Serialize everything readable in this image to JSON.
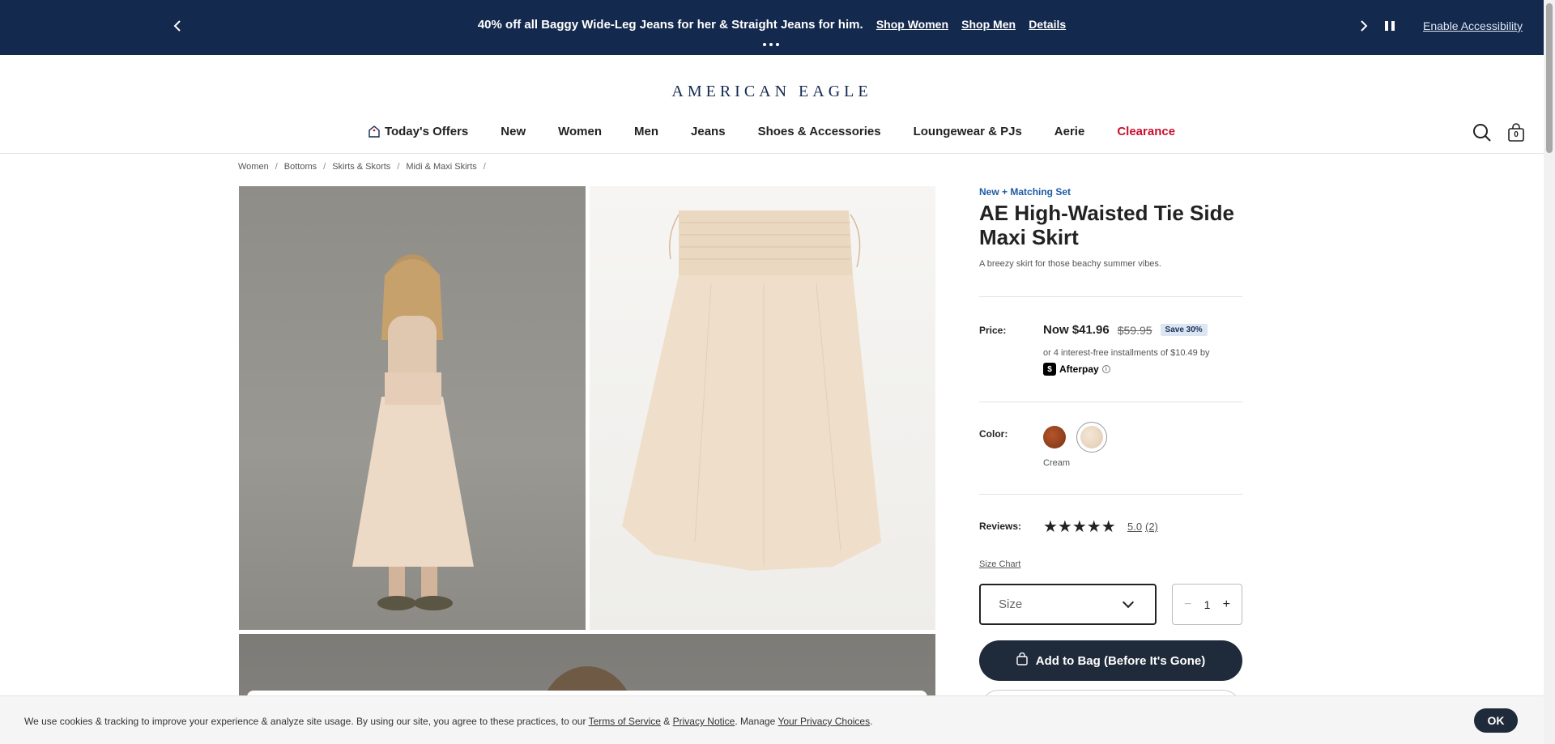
{
  "promo": {
    "message": "40% off all Baggy Wide-Leg Jeans for her & Straight Jeans for him.",
    "links": [
      "Shop Women",
      "Shop Men",
      "Details"
    ],
    "accessibility": "Enable Accessibility",
    "prev_icon": "chevron-left-icon",
    "next_icon": "chevron-right-icon",
    "pause_icon": "pause-icon"
  },
  "brand": "AMERICAN EAGLE",
  "nav": {
    "items": [
      "Today's Offers",
      "New",
      "Women",
      "Men",
      "Jeans",
      "Shoes & Accessories",
      "Loungewear & PJs",
      "Aerie",
      "Clearance"
    ],
    "clearance_color": "#c8102e",
    "bag_count": "0"
  },
  "breadcrumb": [
    "Women",
    "Bottoms",
    "Skirts & Skorts",
    "Midi & Maxi Skirts"
  ],
  "product": {
    "eyebrow": "New + Matching Set",
    "title": "AE High-Waisted Tie Side Maxi Skirt",
    "description": "A breezy skirt for those beachy summer vibes.",
    "price_label": "Price:",
    "now_price": "Now $41.96",
    "was_price": "$59.95",
    "save": "Save 30%",
    "afterpay_text": "or 4 interest-free installments of $10.49 by",
    "afterpay_brand": "Afterpay",
    "color_label": "Color:",
    "color_name": "Cream",
    "colors": [
      "#9a4520",
      "#ead8c2"
    ],
    "reviews_label": "Reviews:",
    "stars": "★★★★★",
    "rating": "5.0",
    "review_count": "(2)",
    "size_chart": "Size Chart",
    "size_placeholder": "Size",
    "quantity": "1",
    "qty_minus": "−",
    "qty_plus": "+",
    "add_to_bag": "Add to Bag (Before It's Gone)"
  },
  "cookie": {
    "text_1": "We use cookies & tracking to improve your experience & analyze site usage. By using our site, you agree to these practices, to our ",
    "terms": "Terms of Service",
    "amp": " & ",
    "privacy": "Privacy Notice",
    "text_2": ". Manage ",
    "choices": "Your Privacy Choices",
    "text_3": ".",
    "ok": "OK"
  },
  "accent_color": "#14294e"
}
